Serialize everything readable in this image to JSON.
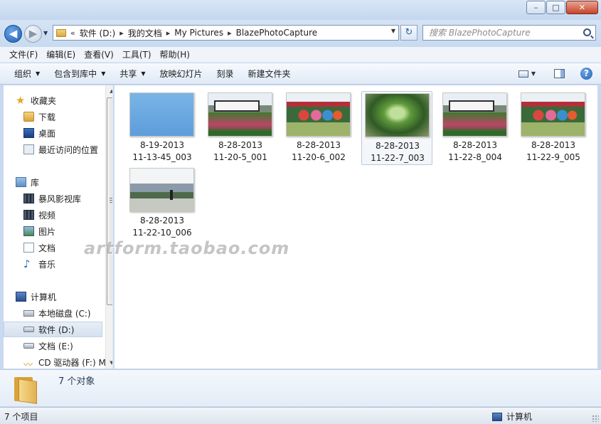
{
  "window": {
    "minimize": "–",
    "maximize": "□",
    "close": "✕"
  },
  "address": {
    "overflow": "«",
    "crumbs": [
      "软件 (D:)",
      "我的文档",
      "My Pictures",
      "BlazePhotoCapture"
    ],
    "separator": "▸"
  },
  "search": {
    "placeholder": "搜索 BlazePhotoCapture"
  },
  "menu": [
    "文件(F)",
    "编辑(E)",
    "查看(V)",
    "工具(T)",
    "帮助(H)"
  ],
  "commands": {
    "organize": "组织",
    "include_library": "包含到库中",
    "share": "共享",
    "slideshow": "放映幻灯片",
    "burn": "刻录",
    "new_folder": "新建文件夹"
  },
  "sidebar": {
    "favorites": {
      "label": "收藏夹",
      "items": [
        "下载",
        "桌面",
        "最近访问的位置"
      ]
    },
    "libraries": {
      "label": "库",
      "items": [
        "暴风影视库",
        "视频",
        "图片",
        "文档",
        "音乐"
      ]
    },
    "computer": {
      "label": "计算机",
      "items": [
        "本地磁盘 (C:)",
        "软件 (D:)",
        "文档 (E:)",
        "CD 驱动器 (F:) M"
      ]
    }
  },
  "files": [
    {
      "line1": "8-19-2013",
      "line2": "11-13-45_003",
      "thumb": "blue"
    },
    {
      "line1": "8-28-2013",
      "line2": "11-20-5_001",
      "thumb": "train"
    },
    {
      "line1": "8-28-2013",
      "line2": "11-20-6_002",
      "thumb": "sign"
    },
    {
      "line1": "8-28-2013",
      "line2": "11-22-7_003",
      "thumb": "plant",
      "selected": true
    },
    {
      "line1": "8-28-2013",
      "line2": "11-22-8_004",
      "thumb": "train"
    },
    {
      "line1": "8-28-2013",
      "line2": "11-22-9_005",
      "thumb": "sign"
    },
    {
      "line1": "8-28-2013",
      "line2": "11-22-10_006",
      "thumb": "park"
    }
  ],
  "watermark": "artform.taobao.com",
  "details": {
    "count_text": "7 个对象"
  },
  "status": {
    "left": "7 个项目",
    "right": "计算机"
  }
}
